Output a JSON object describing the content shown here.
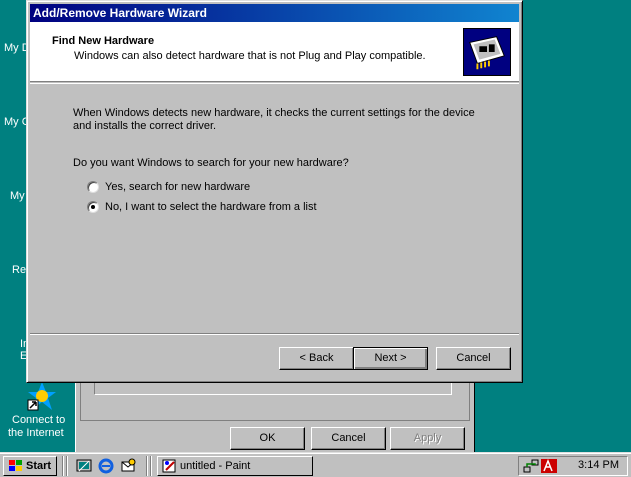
{
  "desktop": {
    "icons": [
      {
        "label": "My D",
        "icon": "my-documents-icon"
      },
      {
        "label": "My C",
        "icon": "my-computer-icon"
      },
      {
        "label": "My",
        "icon": "my-network-icon"
      },
      {
        "label": "Re",
        "icon": "recycle-bin-icon"
      },
      {
        "label": "In",
        "icon": "internet-explorer-icon"
      },
      {
        "label": "E",
        "icon": "internet-explorer-icon"
      },
      {
        "label": "Connect to",
        "icon": "connect-internet-icon"
      },
      {
        "label": "the Internet",
        "icon": "connect-internet-icon"
      }
    ]
  },
  "background_window": {
    "ok_label": "OK",
    "cancel_label": "Cancel",
    "apply_label": "Apply"
  },
  "wizard": {
    "title": "Add/Remove Hardware Wizard",
    "header_title": "Find New Hardware",
    "header_subtitle": "Windows can also detect hardware that is not Plug and Play compatible.",
    "header_icon": "hardware-card-icon",
    "body_line1": "When Windows detects new hardware, it checks the current settings for the device",
    "body_line2": "and installs the correct driver.",
    "question": "Do you want Windows to search for your new hardware?",
    "options": [
      {
        "label": "Yes, search for new hardware",
        "checked": false
      },
      {
        "label": "No, I want to select the hardware from a list",
        "checked": true
      }
    ],
    "back_label": "< Back",
    "next_label": "Next >",
    "cancel_label": "Cancel"
  },
  "taskbar": {
    "start_label": "Start",
    "quicklaunch": [
      "show-desktop-icon",
      "internet-explorer-icon",
      "outlook-express-icon"
    ],
    "task_label": "untitled - Paint",
    "tray_icons": [
      "network-tray-icon",
      "ati-tray-icon"
    ],
    "clock": "3:14 PM"
  },
  "colors": {
    "desktop": "#008080",
    "title_bar": "#000080",
    "face": "#c0c0c0"
  }
}
